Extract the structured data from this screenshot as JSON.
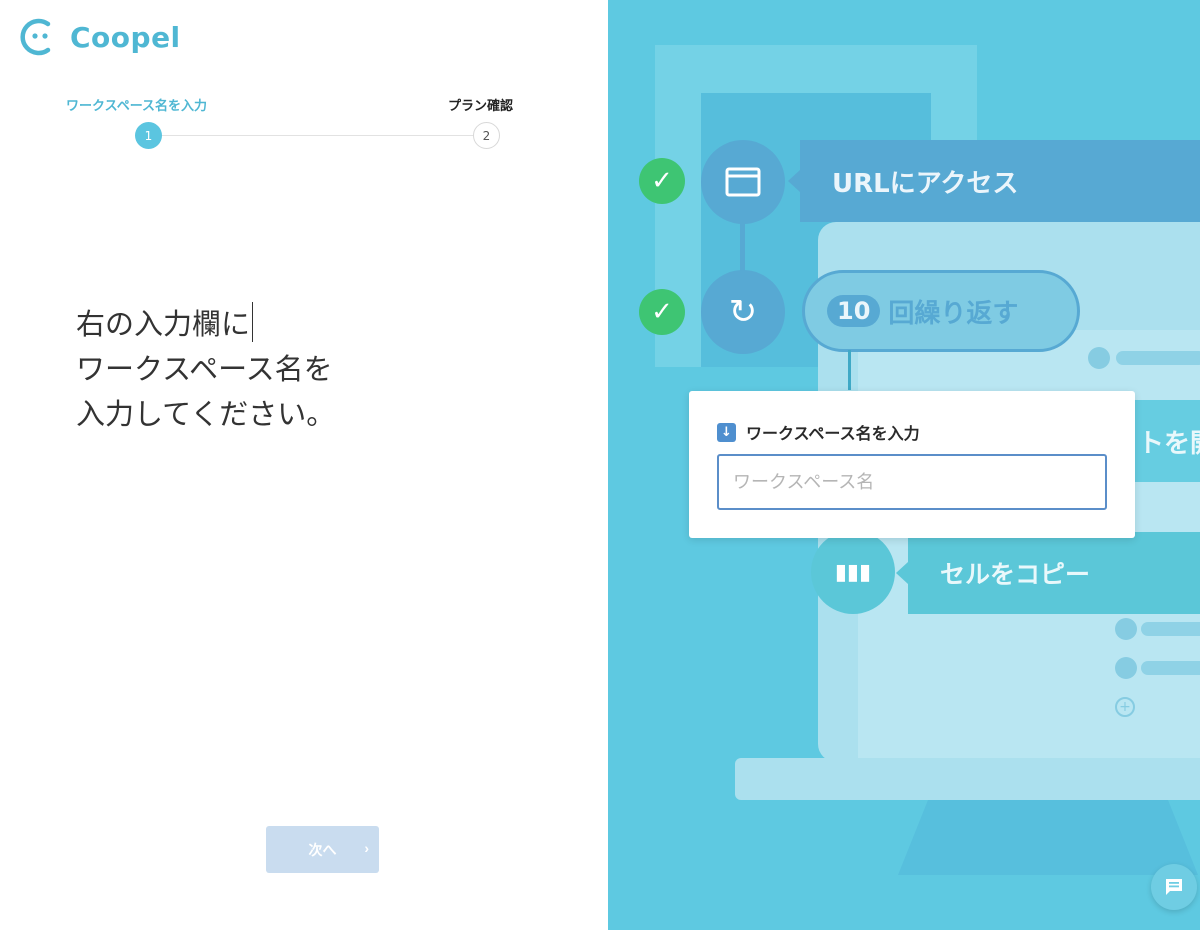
{
  "brand": {
    "name": "Coopel",
    "logo_icon": "coopel-face-logo",
    "accent": "#4fb7d3"
  },
  "stepper": {
    "steps": [
      {
        "number": "1",
        "label": "ワークスペース名を入力",
        "state": "active"
      },
      {
        "number": "2",
        "label": "プラン確認",
        "state": "pending"
      }
    ]
  },
  "instruction": {
    "line1": "右の入力欄に",
    "line2": "ワークスペース名を",
    "line3": "入力してください。"
  },
  "next_button": {
    "label": "次へ",
    "icon": "chevron-right-icon",
    "enabled": false
  },
  "illustration": {
    "step_url": "URLにアクセス",
    "repeat_count": "10",
    "repeat_label": "回繰り返す",
    "partial_label": "トを開",
    "copy_label": "セルをコピー"
  },
  "workspace_form": {
    "label": "ワークスペース名を入力",
    "label_icon": "download-icon",
    "input_value": "",
    "input_placeholder": "ワークスペース名"
  },
  "chat": {
    "icon": "chat-icon"
  }
}
